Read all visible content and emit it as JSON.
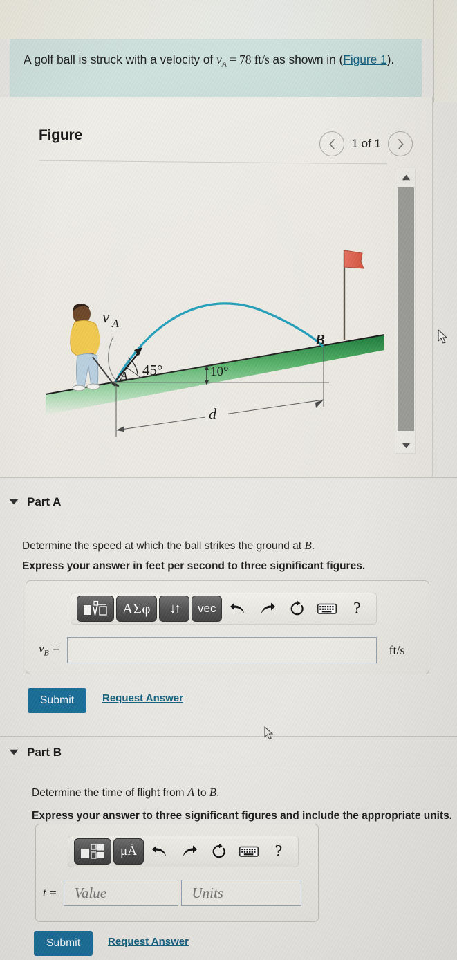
{
  "problem": {
    "text_before": "A golf ball is struck with a velocity of ",
    "symbol_v": "v",
    "symbol_sub": "A",
    "text_eq": " = 78 ",
    "unit": "ft/s",
    "text_after": " as shown in (",
    "link": "Figure 1",
    "text_end": ")."
  },
  "figure": {
    "title": "Figure",
    "prev_icon": "chevron-left-icon",
    "next_icon": "chevron-right-icon",
    "pager_label": "1 of 1",
    "scroll_up_icon": "triangle-up-icon",
    "scroll_down_icon": "triangle-down-icon",
    "diagram": {
      "velocity_label": "v",
      "velocity_sub": "A",
      "launch_angle": "45°",
      "incline_angle": "10°",
      "point_a": "A",
      "point_b": "B",
      "distance_label": "d",
      "colors": {
        "trajectory": "#1c9bb8",
        "ground_dark": "#1d7a3e",
        "ground_light": "#79c98a",
        "flag": "#e8685a",
        "sweater": "#f0c84c",
        "pants": "#b8cfe0",
        "skin": "#6b4426"
      }
    }
  },
  "parts": [
    {
      "caret_icon": "caret-down-icon",
      "title": "Part A",
      "question": "Determine the speed at which the ball strikes the ground at ",
      "question_var": "B",
      "question_end": ".",
      "instruction": "Express your answer in feet per second to three significant figures.",
      "toolbar": [
        {
          "name": "template-sqrt-key",
          "kind": "key",
          "label": "sqrt-template-icon"
        },
        {
          "name": "greek-key",
          "kind": "key",
          "label": "ΑΣφ"
        },
        {
          "name": "arrows-key",
          "kind": "key",
          "label": "↓↑"
        },
        {
          "name": "vec-key",
          "kind": "key",
          "label": "vec"
        },
        {
          "name": "undo-icon",
          "kind": "icon",
          "label": "↰"
        },
        {
          "name": "redo-icon",
          "kind": "icon",
          "label": "↱"
        },
        {
          "name": "reset-icon",
          "kind": "icon",
          "label": "↻"
        },
        {
          "name": "keyboard-icon",
          "kind": "icon",
          "label": "⌨"
        },
        {
          "name": "help-icon",
          "kind": "icon",
          "label": "?"
        }
      ],
      "field_label_sym": "v",
      "field_label_sub": "B",
      "field_label_eq": " =",
      "field_value": "",
      "field_placeholder": "",
      "unit": "ft/s",
      "submit_label": "Submit",
      "request_label": "Request Answer"
    },
    {
      "caret_icon": "caret-down-icon",
      "title": "Part B",
      "question": "Determine the time of flight from ",
      "question_var": "A",
      "question_mid": " to ",
      "question_var2": "B",
      "question_end": ".",
      "instruction": "Express your answer to three significant figures and include the appropriate units.",
      "toolbar": [
        {
          "name": "template-key",
          "kind": "key",
          "label": "template-icon"
        },
        {
          "name": "units-key",
          "kind": "key",
          "label": "μÅ"
        },
        {
          "name": "undo-icon",
          "kind": "icon",
          "label": "↰"
        },
        {
          "name": "redo-icon",
          "kind": "icon",
          "label": "↱"
        },
        {
          "name": "reset-icon",
          "kind": "icon",
          "label": "↻"
        },
        {
          "name": "keyboard-icon",
          "kind": "icon",
          "label": "⌨"
        },
        {
          "name": "help-icon",
          "kind": "icon",
          "label": "?"
        }
      ],
      "field_label_sym": "t",
      "field_label_eq": " =",
      "value_placeholder": "Value",
      "units_placeholder": "Units",
      "submit_label": "Submit",
      "request_label": "Request Answer"
    }
  ],
  "colors": {
    "accent_blue": "#1a6e99",
    "link_blue": "#14607f",
    "statement_bg": "#cfe0dc"
  }
}
